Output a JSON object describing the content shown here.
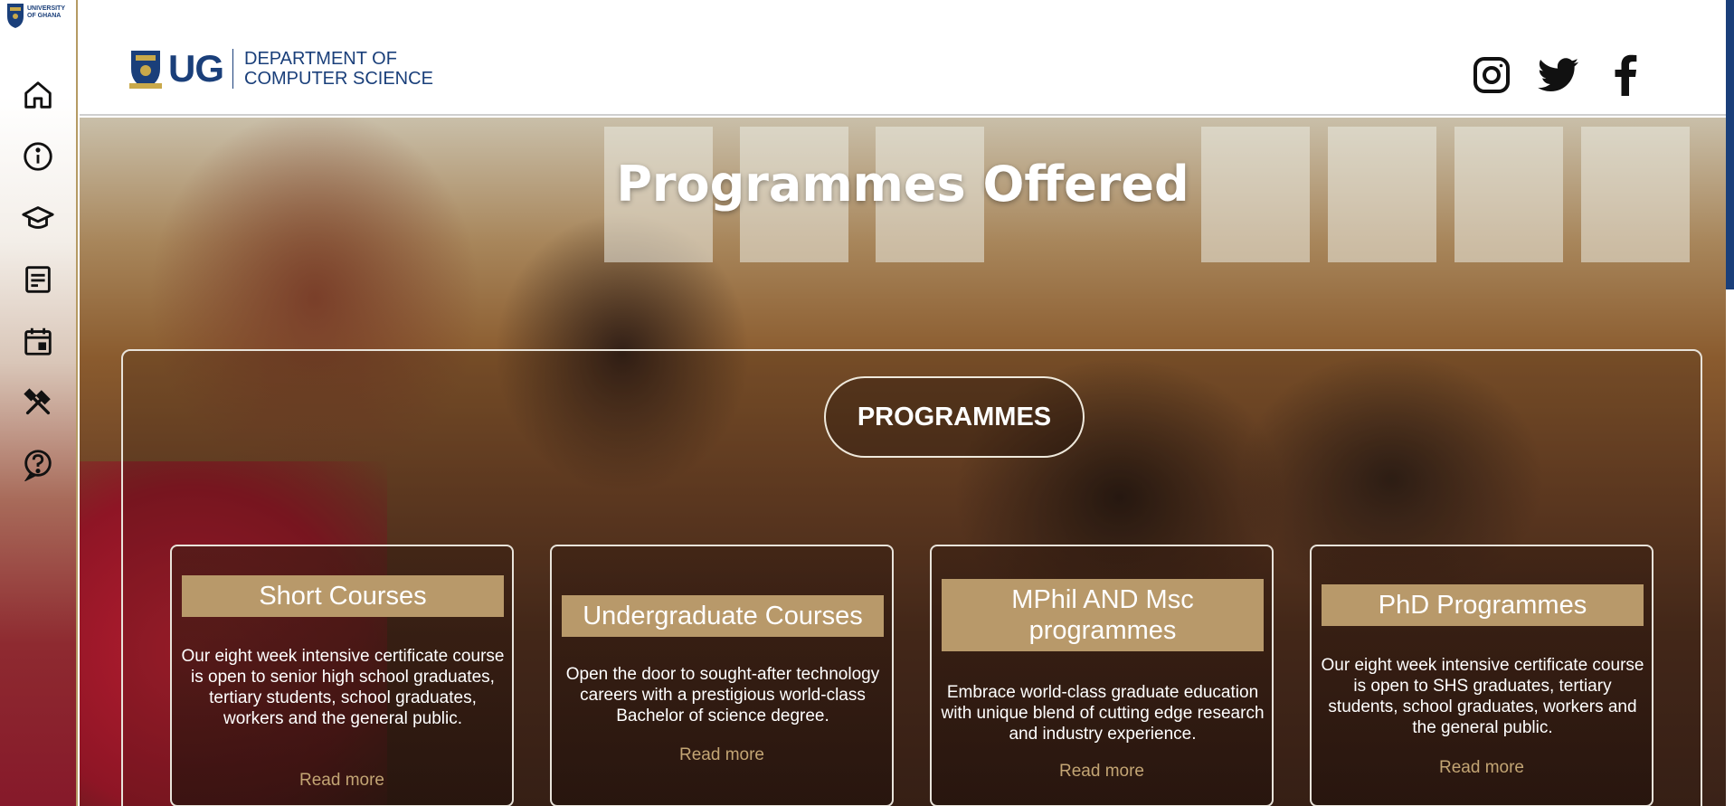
{
  "sidebar": {
    "logo_text": "UNIVERSITY OF GHANA",
    "items": [
      {
        "name": "home-icon"
      },
      {
        "name": "info-icon"
      },
      {
        "name": "graduation-cap-icon"
      },
      {
        "name": "document-icon"
      },
      {
        "name": "calendar-icon"
      },
      {
        "name": "tools-icon"
      },
      {
        "name": "help-icon"
      }
    ]
  },
  "header": {
    "brand_short": "UG",
    "dept_line1": "DEPARTMENT OF",
    "dept_line2": "COMPUTER SCIENCE",
    "socials": [
      "instagram-icon",
      "twitter-icon",
      "facebook-icon"
    ]
  },
  "hero": {
    "title": "Programmes Offered",
    "section_label": "PROGRAMMES"
  },
  "cards": [
    {
      "title": "Short Courses",
      "description": "Our eight week intensive certificate course is open to senior high school graduates, tertiary students, school graduates, workers and the general public.",
      "link": "Read more"
    },
    {
      "title": "Undergraduate Courses",
      "description": "Open the door to sought-after technology careers with a prestigious world-class Bachelor of science degree.",
      "link": "Read more"
    },
    {
      "title": "MPhil AND Msc programmes",
      "description": "Embrace world-class graduate education with unique blend of cutting edge research and industry experience.",
      "link": "Read more"
    },
    {
      "title": "PhD Programmes",
      "description": "Our eight week intensive certificate course is open to SHS graduates, tertiary students, school graduates, workers and the general public.",
      "link": "Read more"
    }
  ],
  "colors": {
    "brand_blue": "#1a3f7a",
    "accent_gold": "#b8996a",
    "link_gold": "#c3a574"
  }
}
